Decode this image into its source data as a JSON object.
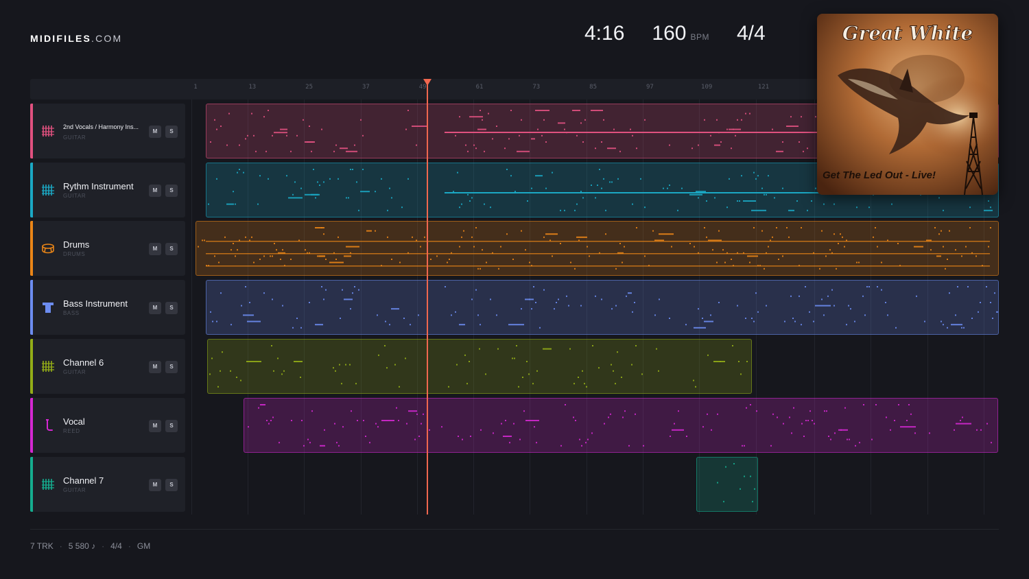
{
  "brand": {
    "bold": "MIDIFILES",
    "light": ".COM"
  },
  "header": {
    "time": "4:16",
    "tempo": "160",
    "tempo_unit": "BPM",
    "time_signature": "4/4"
  },
  "album": {
    "artist_logo": "Great White",
    "album_title": "Get The Led Out - Live!"
  },
  "ruler": {
    "labels": [
      "1",
      "13",
      "25",
      "37",
      "49",
      "61",
      "73",
      "85",
      "97",
      "109",
      "121"
    ]
  },
  "playhead": {
    "bar": 50
  },
  "tracks": [
    {
      "name": "2nd Vocals / Harmony Ins...",
      "type": "GUITAR",
      "icon": "guitar-icon",
      "color": "#e0517f",
      "mute": "M",
      "solo": "S"
    },
    {
      "name": "Rythm Instrument",
      "type": "GUITAR",
      "icon": "guitar-icon",
      "color": "#1ba8c4",
      "mute": "M",
      "solo": "S"
    },
    {
      "name": "Drums",
      "type": "DRUMS",
      "icon": "drum-icon",
      "color": "#ea8517",
      "mute": "M",
      "solo": "S"
    },
    {
      "name": "Bass Instrument",
      "type": "BASS",
      "icon": "bass-icon",
      "color": "#6c8cf0",
      "mute": "M",
      "solo": "S"
    },
    {
      "name": "Channel 6",
      "type": "GUITAR",
      "icon": "guitar-icon",
      "color": "#93ad17",
      "mute": "M",
      "solo": "S"
    },
    {
      "name": "Vocal",
      "type": "REED",
      "icon": "reed-icon",
      "color": "#d428d2",
      "mute": "M",
      "solo": "S"
    },
    {
      "name": "Channel 7",
      "type": "GUITAR",
      "icon": "guitar-icon",
      "color": "#15ad8f",
      "mute": "M",
      "solo": "S"
    }
  ],
  "footer": {
    "tracks": "7 TRK",
    "notes": "5 580 ♪",
    "time_signature": "4/4",
    "standard": "GM"
  }
}
